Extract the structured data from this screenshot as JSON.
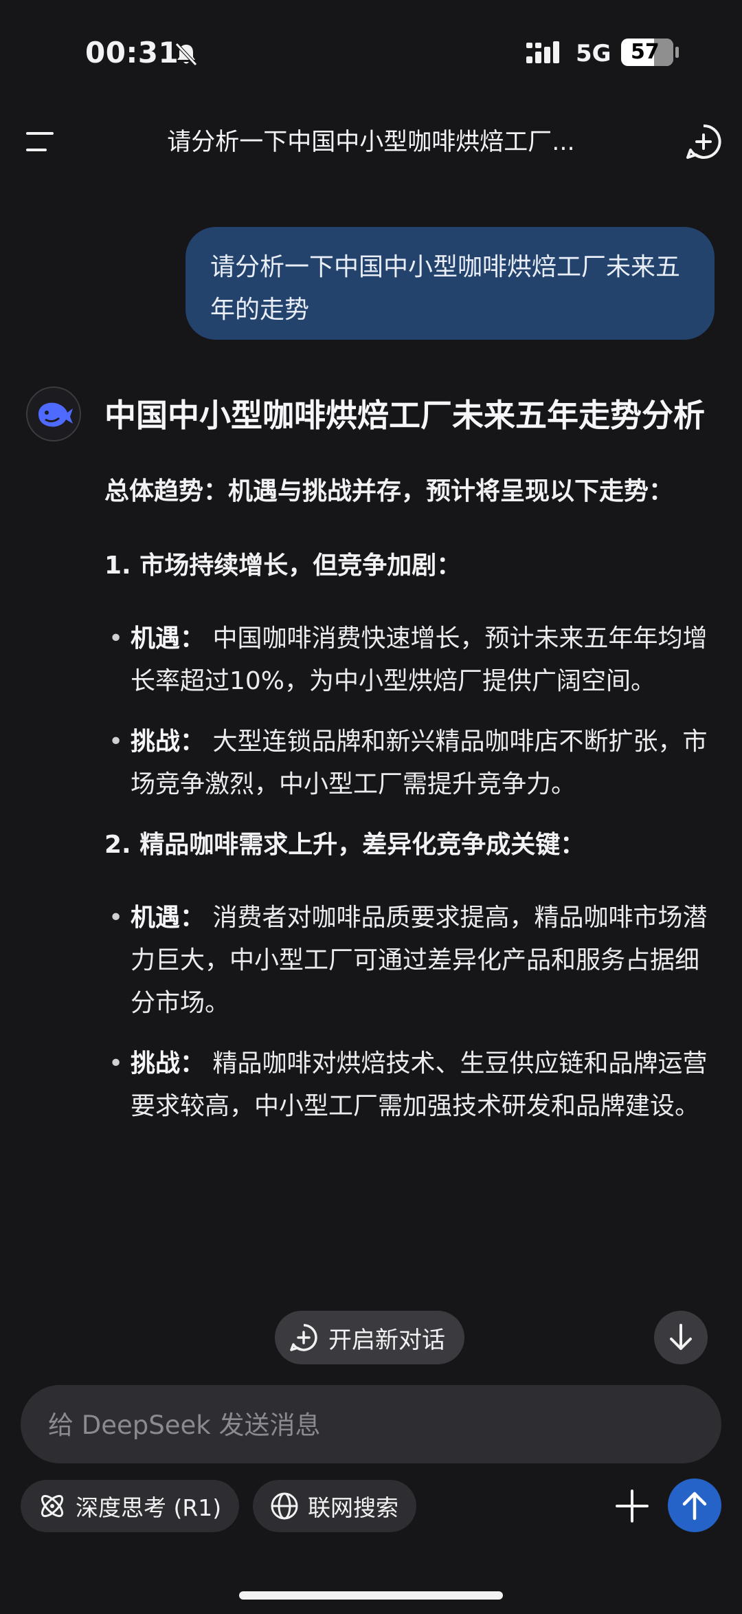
{
  "status": {
    "time": "00:31",
    "network": "5G",
    "battery": "57",
    "icons": [
      "bell-muted-icon",
      "signal-icon",
      "battery-icon"
    ]
  },
  "header": {
    "title": "请分析一下中国中小型咖啡烘焙工厂...",
    "icons": [
      "menu-icon",
      "new-chat-icon"
    ]
  },
  "user_message": "请分析一下中国中小型咖啡烘焙工厂未来五年的走势",
  "assistant": {
    "avatar_icon": "deepseek-whale-icon",
    "title": "中国中小型咖啡烘焙工厂未来五年走势分析",
    "summary": "总体趋势：机遇与挑战并存，预计将呈现以下走势：",
    "sections": [
      {
        "heading": "1. 市场持续增长，但竞争加剧：",
        "items": [
          {
            "label": "机遇：",
            "text": "中国咖啡消费快速增长，预计未来五年年均增长率超过10%，为中小型烘焙厂提供广阔空间。"
          },
          {
            "label": "挑战：",
            "text": "大型连锁品牌和新兴精品咖啡店不断扩张，市场竞争激烈，中小型工厂需提升竞争力。"
          }
        ]
      },
      {
        "heading": "2. 精品咖啡需求上升，差异化竞争成关键：",
        "items": [
          {
            "label": "机遇：",
            "text": "消费者对咖啡品质要求提高，精品咖啡市场潜力巨大，中小型工厂可通过差异化产品和服务占据细分市场。"
          },
          {
            "label": "挑战：",
            "text": "精品咖啡对烘焙技术、生豆供应链和品牌运营要求较高，中小型工厂需加强技术研发和品牌建设。"
          }
        ]
      }
    ]
  },
  "floating": {
    "new_chat_label": "开启新对话",
    "icons": [
      "new-chat-plus-icon",
      "arrow-down-icon"
    ]
  },
  "composer": {
    "placeholder": "给 DeepSeek 发送消息",
    "deep_think_label": "深度思考 (R1)",
    "web_search_label": "联网搜索",
    "icons": [
      "atom-icon",
      "globe-icon",
      "plus-icon",
      "send-arrow-icon"
    ]
  },
  "colors": {
    "background": "#161618",
    "user_bubble": "#23436d",
    "accent": "#2563c8",
    "pill": "#2e2e32"
  }
}
